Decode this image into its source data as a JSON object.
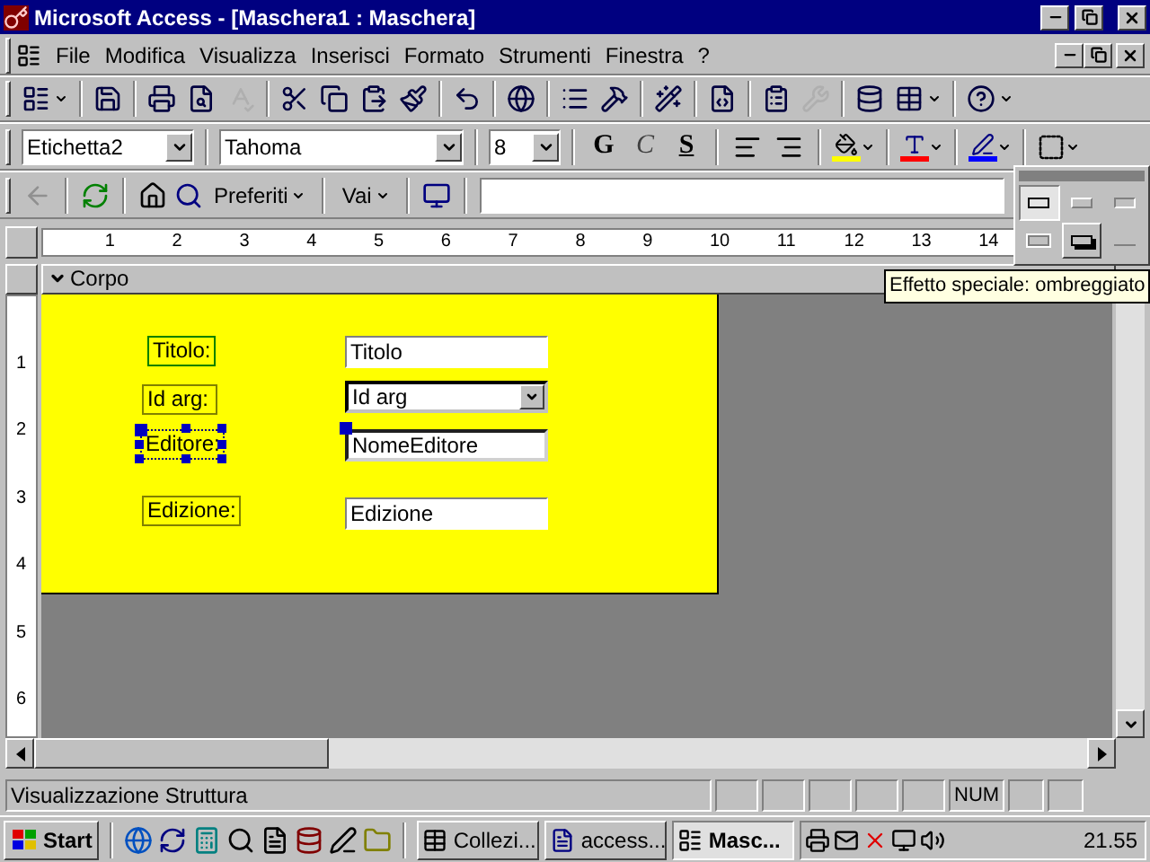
{
  "window": {
    "title": "Microsoft Access - [Maschera1 : Maschera]"
  },
  "menu": [
    "File",
    "Modifica",
    "Visualizza",
    "Inserisci",
    "Formato",
    "Strumenti",
    "Finestra",
    "?"
  ],
  "toolbar": [
    {
      "kind": "view",
      "disabled": false
    },
    {
      "kind": "separator"
    },
    {
      "kind": "save",
      "disabled": false
    },
    {
      "kind": "separator"
    },
    {
      "kind": "print",
      "disabled": false
    },
    {
      "kind": "preview",
      "disabled": false
    },
    {
      "kind": "spelling",
      "disabled": true
    },
    {
      "kind": "separator"
    },
    {
      "kind": "cut",
      "disabled": false
    },
    {
      "kind": "copy",
      "disabled": false
    },
    {
      "kind": "paste",
      "disabled": false
    },
    {
      "kind": "painter",
      "disabled": false
    },
    {
      "kind": "separator"
    },
    {
      "kind": "undo",
      "disabled": false
    },
    {
      "kind": "separator"
    },
    {
      "kind": "hyperlink",
      "disabled": false
    },
    {
      "kind": "separator"
    },
    {
      "kind": "fieldlist",
      "disabled": false
    },
    {
      "kind": "toolbox",
      "disabled": false
    },
    {
      "kind": "separator"
    },
    {
      "kind": "autoformat",
      "disabled": false
    },
    {
      "kind": "separator"
    },
    {
      "kind": "code",
      "disabled": false
    },
    {
      "kind": "separator"
    },
    {
      "kind": "properties",
      "disabled": false
    },
    {
      "kind": "build",
      "disabled": true
    },
    {
      "kind": "separator"
    },
    {
      "kind": "database",
      "disabled": false
    },
    {
      "kind": "newobject",
      "disabled": false
    },
    {
      "kind": "separator"
    },
    {
      "kind": "help",
      "disabled": false
    }
  ],
  "format_bar": {
    "object": "Etichetta2",
    "font": "Tahoma",
    "size": "8",
    "bold": "G",
    "italic": "C",
    "underline": "S"
  },
  "web_bar": {
    "favorites": "Preferiti",
    "go": "Vai"
  },
  "effect_palette": [
    {
      "kind": "flat",
      "selected": true,
      "hovered": false
    },
    {
      "kind": "raised",
      "selected": false,
      "hovered": false
    },
    {
      "kind": "sunken",
      "selected": false,
      "hovered": false
    },
    {
      "kind": "etched",
      "selected": false,
      "hovered": false
    },
    {
      "kind": "shadowed",
      "selected": false,
      "hovered": true
    },
    {
      "kind": "chiseled",
      "selected": false,
      "hovered": false
    }
  ],
  "tooltip": "Effetto speciale: ombreggiato",
  "ruler": {
    "horizontal": [
      "1",
      "2",
      "3",
      "4",
      "5",
      "6",
      "7",
      "8",
      "9",
      "10",
      "11",
      "12",
      "13",
      "14"
    ],
    "vertical": [
      "1",
      "2",
      "3",
      "4",
      "5",
      "6"
    ]
  },
  "section": "Corpo",
  "controls": [
    {
      "label": {
        "text": "Titolo:",
        "selected": false
      },
      "field": {
        "kind": "textbox",
        "text": "Titolo",
        "selected": false
      }
    },
    {
      "label": {
        "text": "Id arg:",
        "selected": false
      },
      "field": {
        "kind": "combo",
        "text": "Id arg",
        "selected": false
      }
    },
    {
      "label": {
        "text": "Editore:",
        "selected": true
      },
      "field": {
        "kind": "textbox",
        "text": "NomeEditore",
        "selected": true
      }
    },
    {
      "label": {
        "text": "Edizione:",
        "selected": false
      },
      "field": {
        "kind": "textbox",
        "text": "Edizione",
        "selected": false
      }
    }
  ],
  "status_bar": {
    "text": "Visualizzazione Struttura",
    "indicators": [
      {
        "label": "NUM"
      }
    ]
  },
  "taskbar": {
    "start": "Start",
    "tasks": [
      {
        "label": "Collezi...",
        "kind": "database",
        "selected": false
      },
      {
        "label": "access...",
        "kind": "word",
        "selected": false
      },
      {
        "label": "Masc...",
        "kind": "form",
        "selected": true
      }
    ],
    "clock": "21.55"
  }
}
